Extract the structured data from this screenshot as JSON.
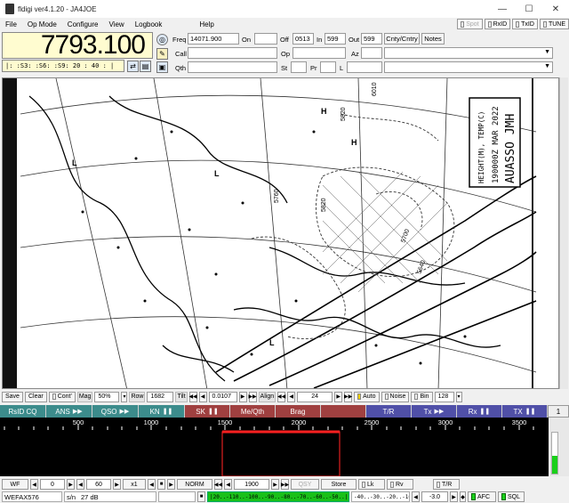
{
  "window": {
    "title": "fldigi ver4.1.20 - JA4JOE",
    "controls": {
      "minimize": "—",
      "maximize": "☐",
      "close": "✕"
    }
  },
  "menu": {
    "items": [
      "File",
      "Op Mode",
      "Configure",
      "View",
      "Logbook",
      "Help"
    ],
    "toggles": [
      {
        "label": "Spot",
        "enabled": false
      },
      {
        "label": "RxID",
        "enabled": true
      },
      {
        "label": "TxID",
        "enabled": true
      },
      {
        "label": "TUNE",
        "enabled": true
      }
    ]
  },
  "rig": {
    "frequency": "7793.100",
    "smeter": "|: :S3: :S6: :S9: 20 : 40 : |"
  },
  "log": {
    "freq_label": "Freq",
    "freq_value": "14071.900",
    "on_label": "On",
    "on_value": "",
    "off_label": "Off",
    "off_value": "0513",
    "in_label": "In",
    "in_value": "599",
    "out_label": "Out",
    "out_value": "599",
    "cnty_button": "Cnty/Cntry",
    "notes_button": "Notes",
    "call_label": "Call",
    "call_value": "",
    "op_label": "Op",
    "op_value": "",
    "az_label": "Az",
    "az_value": "",
    "qth_label": "Qth",
    "qth_value": "",
    "st_label": "St",
    "st_value": "",
    "pr_label": "Pr",
    "pr_value": "",
    "l_label": "L",
    "l_value": ""
  },
  "fax": {
    "title_lines": [
      "AUASSO JMH",
      "190000Z MAR 2022",
      "HEIGHT(M), TEMP(C)"
    ],
    "map_labels": [
      "H",
      "H",
      "L",
      "L",
      "L",
      "5820",
      "5820",
      "5700",
      "5640",
      "5760",
      "6010"
    ]
  },
  "controls": {
    "save": "Save",
    "clear": "Clear",
    "cont": "Cont'",
    "mag_label": "Mag",
    "mag_value": "50%",
    "row_label": "Row",
    "row_value": "1682",
    "tilt_label": "Tilt",
    "tilt_value": "0.0107",
    "align_label": "Align",
    "align_value": "24",
    "auto": "Auto",
    "noise": "Noise",
    "bin": "Bin",
    "bin_value": "128"
  },
  "macros": [
    {
      "label": "RsID CQ",
      "color": "#3c8c8c"
    },
    {
      "label": "ANS",
      "color": "#3c8c8c"
    },
    {
      "label": "QSO",
      "color": "#3c8c8c"
    },
    {
      "label": "KN",
      "color": "#3c8c8c"
    },
    {
      "label": "SK",
      "color": "#a04040"
    },
    {
      "label": "Me/Qth",
      "color": "#a04040"
    },
    {
      "label": "Brag",
      "color": "#a04040"
    },
    {
      "label": "",
      "color": "#a04040"
    },
    {
      "label": "T/R",
      "color": "#5050a8"
    },
    {
      "label": "Tx",
      "color": "#5050a8"
    },
    {
      "label": "Rx",
      "color": "#5050a8"
    },
    {
      "label": "TX",
      "color": "#5050a8"
    }
  ],
  "macro_bank": "1",
  "scale_ticks": [
    "500",
    "1000",
    "1500",
    "2000",
    "2500",
    "3000",
    "3500"
  ],
  "waterfall": {
    "wf_button": "WF",
    "lower": "0",
    "upper": "60",
    "zoom": "x1",
    "speed": "NORM",
    "carrier": "1900",
    "qsy": "QSY",
    "store": "Store",
    "lk": "Lk",
    "rv": "Rv",
    "tr": "T/R"
  },
  "status": {
    "mode": "WEFAX576",
    "sn_label": "s/n",
    "sn_value": "27 dB",
    "dbscale_green": "|20..-110..-100..-90..-80..-70..-60..-50..|",
    "dbscale_rest": "-40..-30..-20..-10..|",
    "offset": "-3.0",
    "afc": "AFC",
    "sql": "SQL"
  }
}
